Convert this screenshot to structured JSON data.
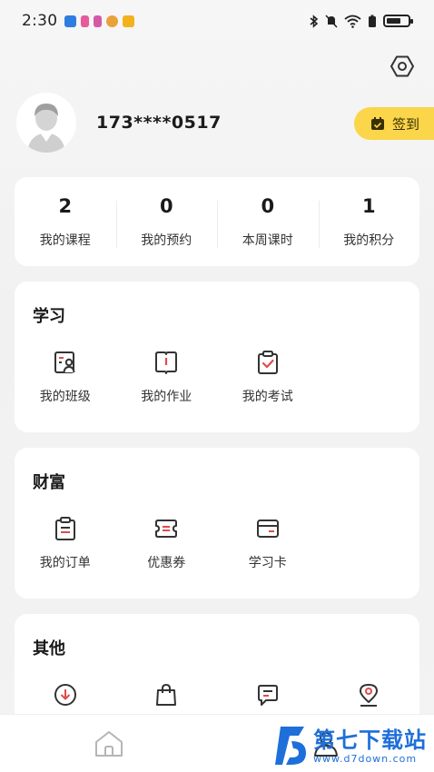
{
  "status_bar": {
    "time": "2:30",
    "notification_icons": [
      "shield-app-icon",
      "app-icon-pink",
      "app-icon-pink-2",
      "weibo-icon",
      "app-icon-yellow"
    ],
    "system_icons": [
      "bluetooth-icon",
      "mute-icon",
      "wifi-icon",
      "battery-saver-icon",
      "battery-icon"
    ]
  },
  "profile": {
    "phone": "173****0517"
  },
  "signin": {
    "label": "签到"
  },
  "stats": [
    {
      "value": "2",
      "label": "我的课程"
    },
    {
      "value": "0",
      "label": "我的预约"
    },
    {
      "value": "0",
      "label": "本周课时"
    },
    {
      "value": "1",
      "label": "我的积分"
    }
  ],
  "learn": {
    "title": "学习",
    "items": [
      {
        "label": "我的班级",
        "icon": "class-icon"
      },
      {
        "label": "我的作业",
        "icon": "homework-book-icon"
      },
      {
        "label": "我的考试",
        "icon": "exam-clipboard-icon"
      }
    ]
  },
  "wealth": {
    "title": "财富",
    "items": [
      {
        "label": "我的订单",
        "icon": "order-clipboard-icon"
      },
      {
        "label": "优惠券",
        "icon": "coupon-icon"
      },
      {
        "label": "学习卡",
        "icon": "study-card-icon"
      }
    ]
  },
  "other": {
    "title": "其他",
    "items": [
      {
        "icon": "download-icon"
      },
      {
        "icon": "shopping-bag-icon"
      },
      {
        "icon": "message-icon"
      },
      {
        "icon": "location-pin-icon"
      }
    ]
  },
  "tabs": [
    {
      "icon": "home-icon"
    },
    {
      "icon": "profile-icon"
    }
  ],
  "watermark": {
    "title": "第七下载站",
    "url": "www.d7down.com"
  },
  "colors": {
    "accent_red": "#e24b4b",
    "signin_yellow": "#fbd54a",
    "watermark_blue": "#1e6fd9"
  }
}
